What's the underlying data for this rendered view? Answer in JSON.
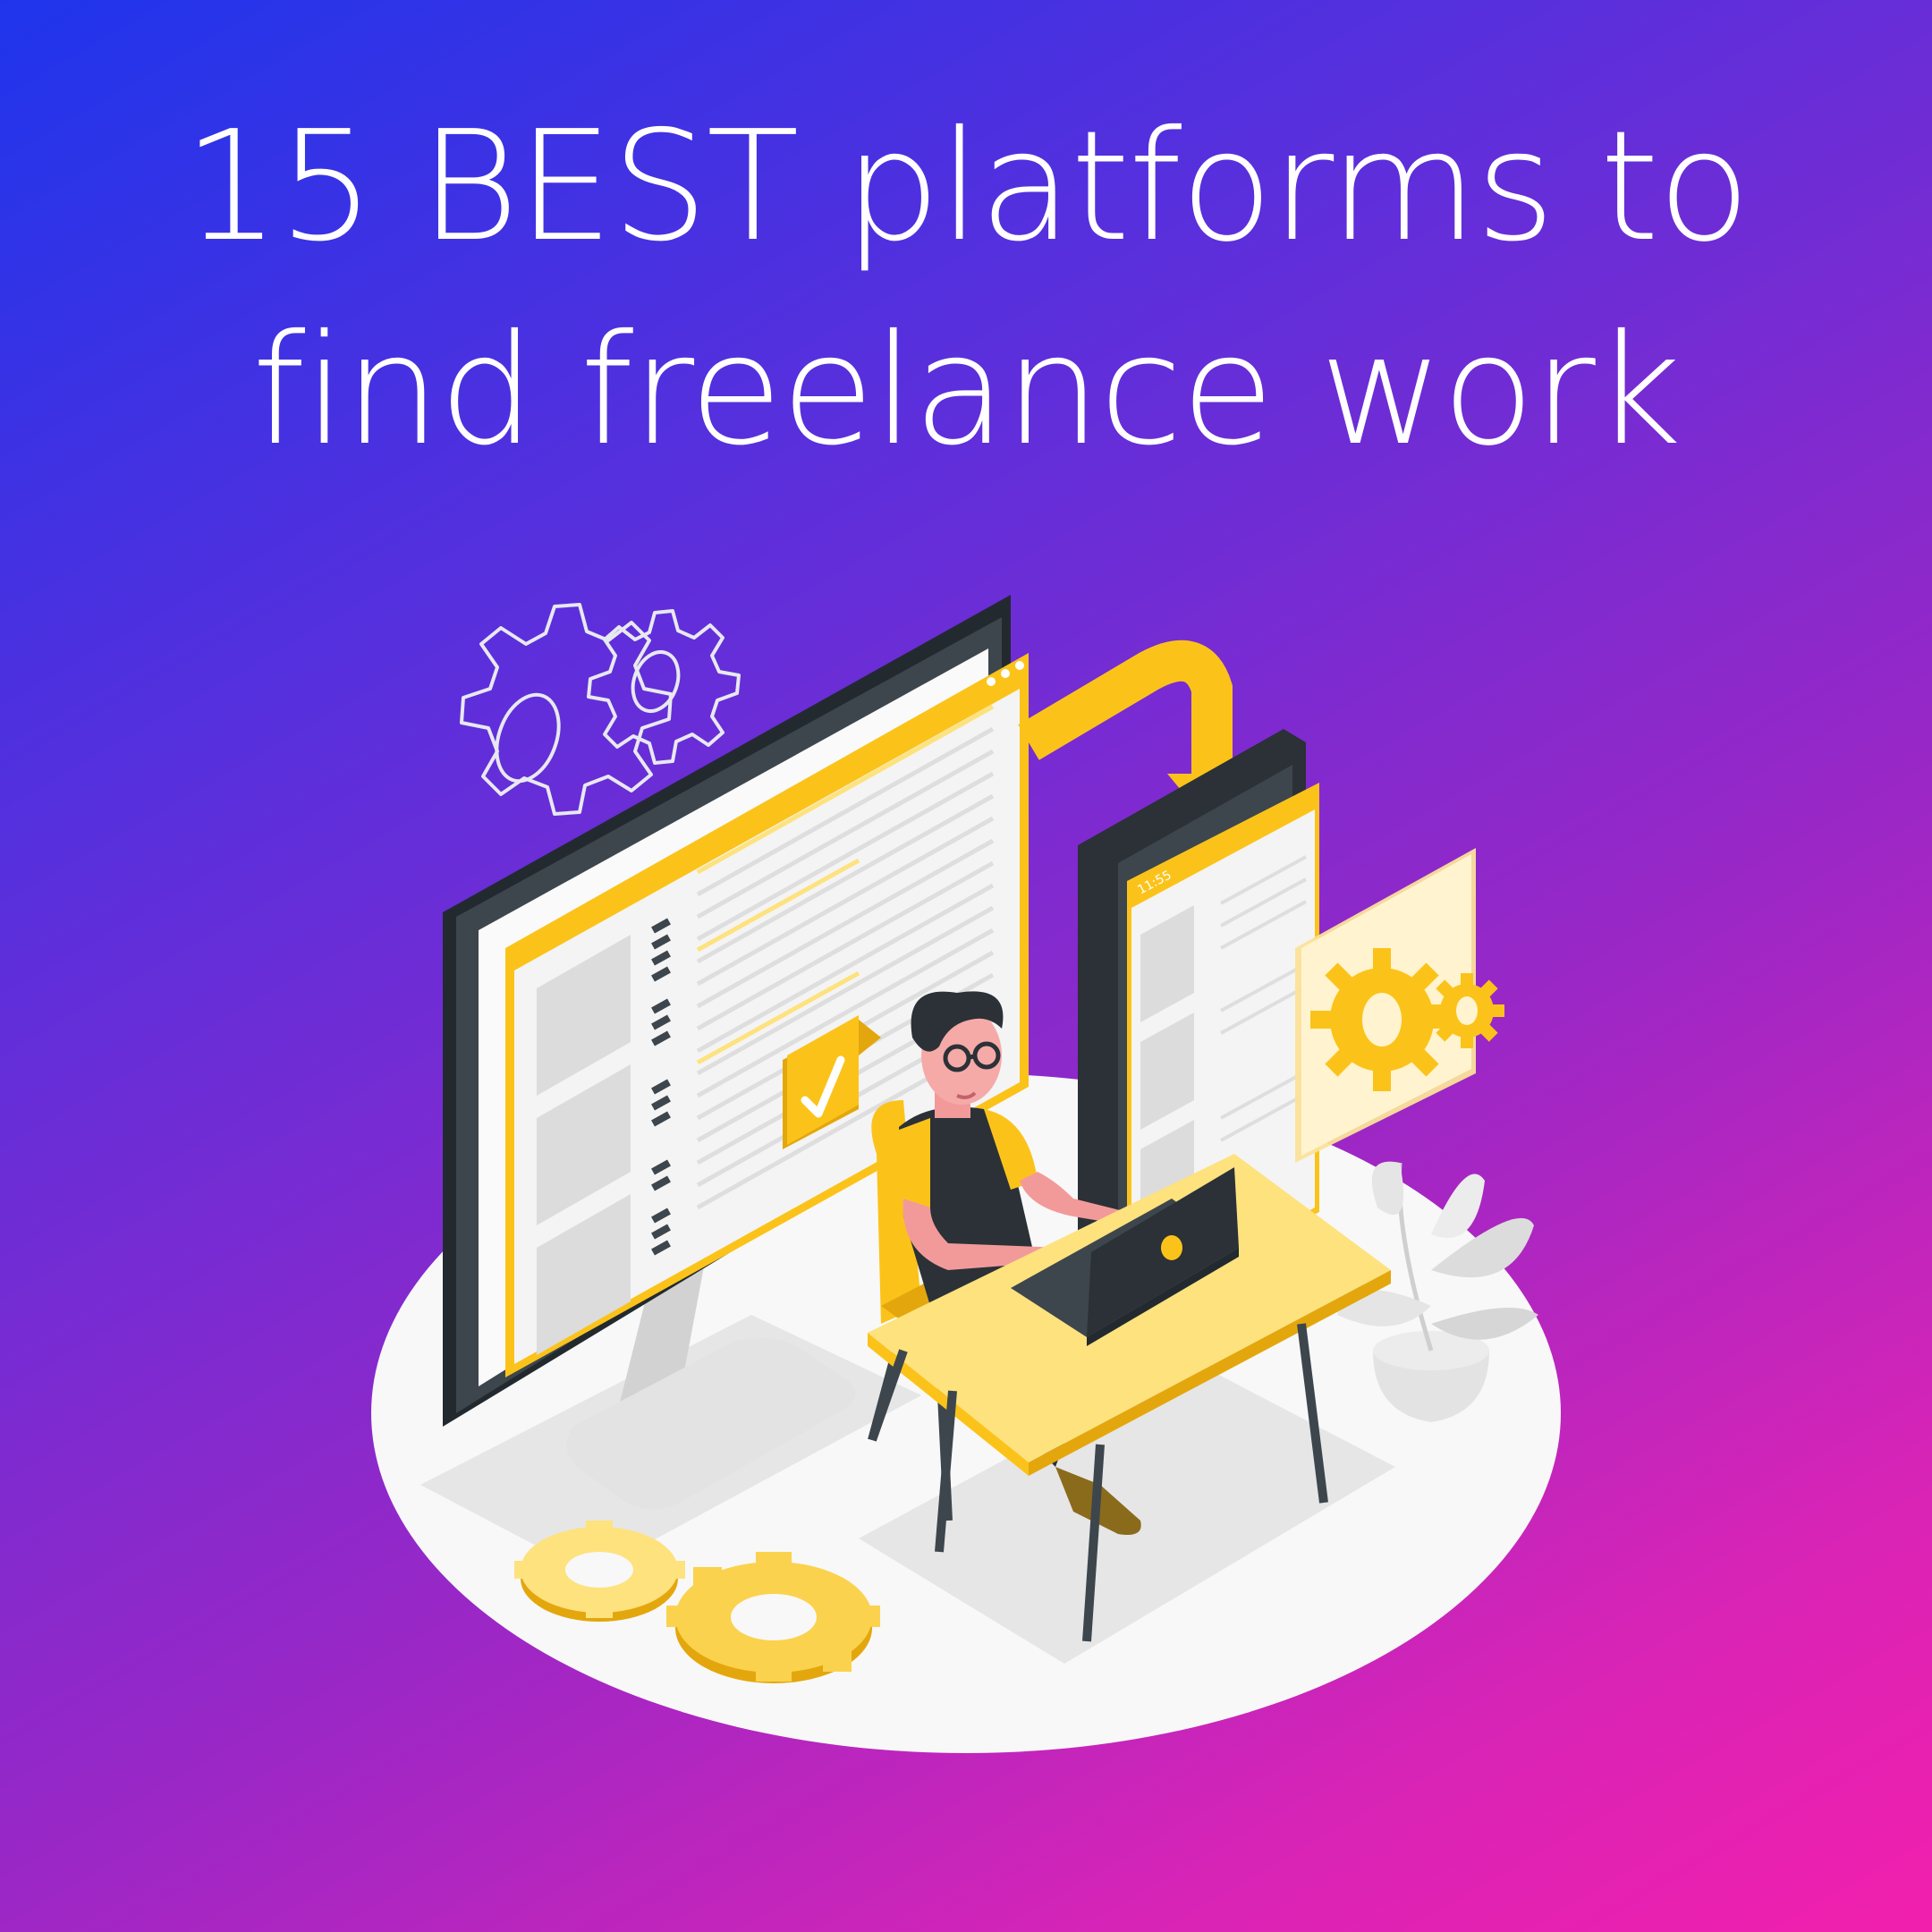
{
  "headline": {
    "line1": "15 BEST platforms to",
    "line2": "find freelance work"
  },
  "illustration": {
    "phone_clock": "11:55",
    "colors": {
      "accent": "#fbc31a",
      "accent_light": "#fde27e",
      "dark": "#2b3137",
      "platform": "#f7f7f7",
      "bg_start": "#1f35ec",
      "bg_end": "#f21fad"
    }
  }
}
